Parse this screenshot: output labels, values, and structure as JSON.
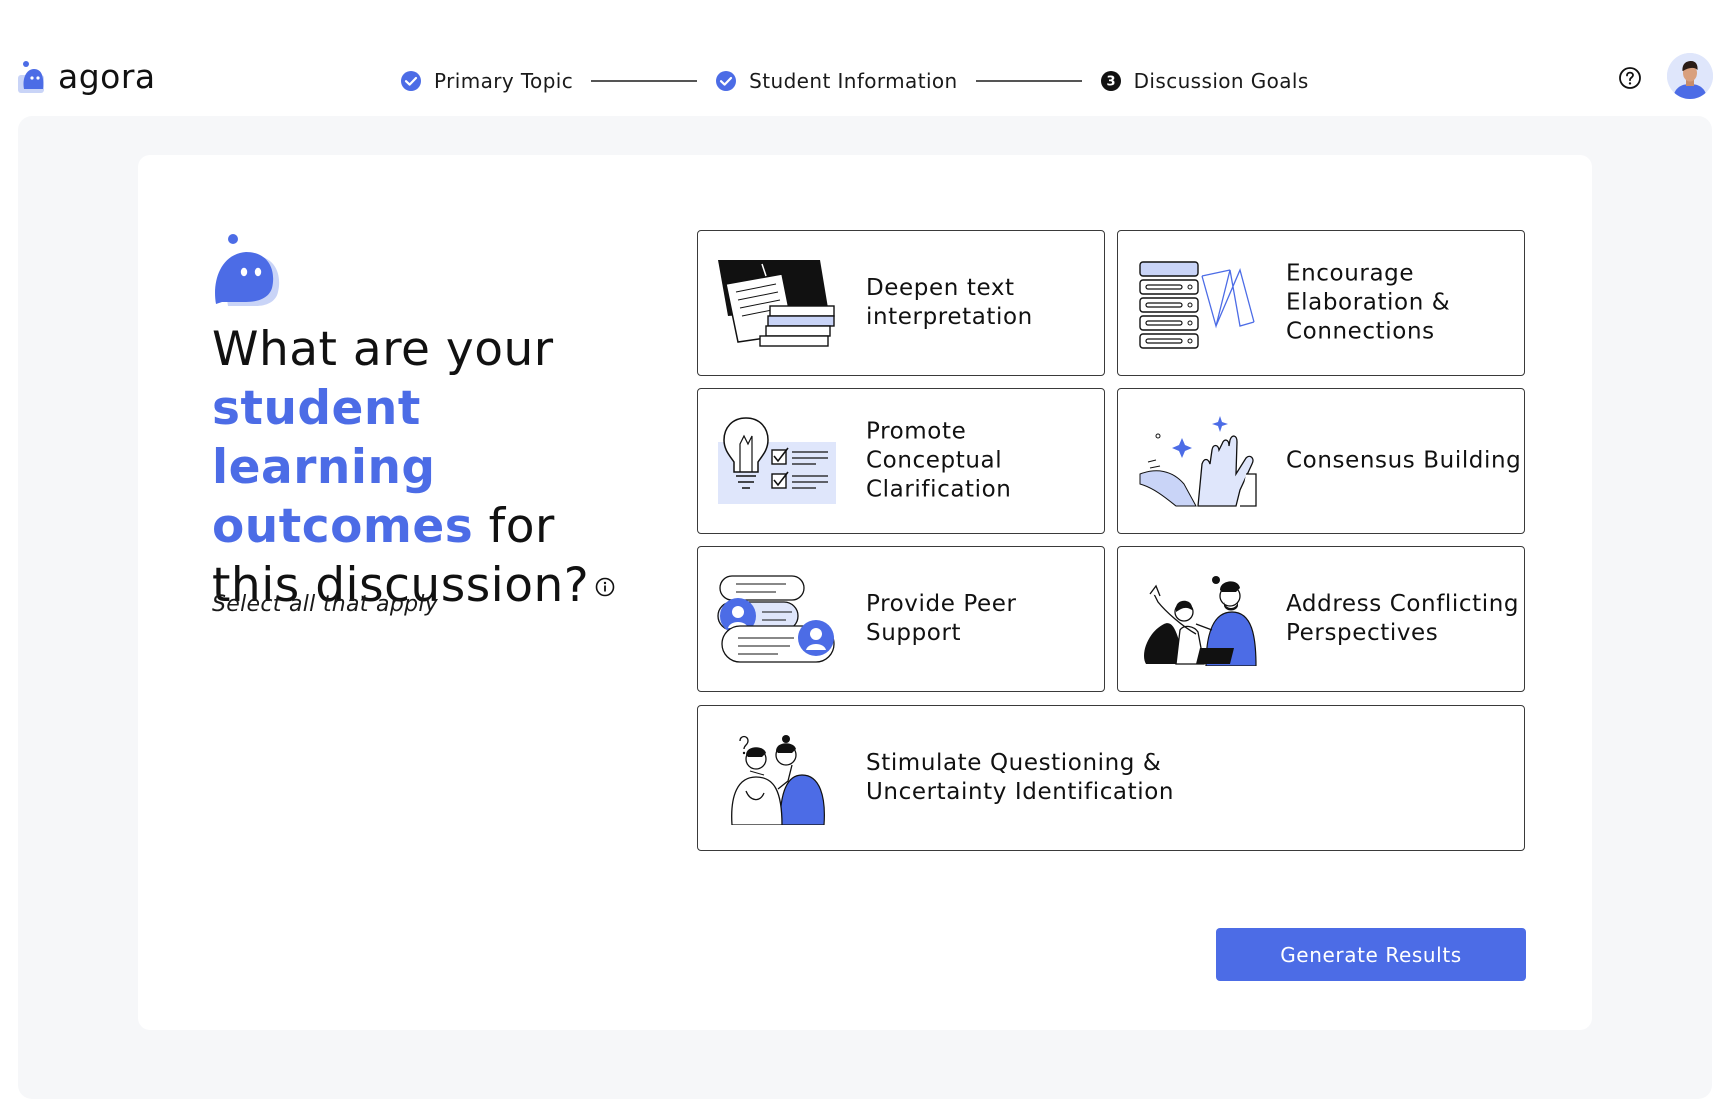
{
  "app": {
    "name": "agora"
  },
  "stepper": {
    "steps": [
      {
        "label": "Primary Topic",
        "state": "complete"
      },
      {
        "label": "Student Information",
        "state": "complete"
      },
      {
        "label": "Discussion Goals",
        "state": "current",
        "number": "3"
      }
    ]
  },
  "question": {
    "prefix": "What are your ",
    "highlight": "student learning outcomes",
    "suffix": " for this discussion?",
    "instruction": "Select all that apply"
  },
  "options": [
    {
      "label": "Deepen text interpretation",
      "icon": "books-papers-illustration"
    },
    {
      "label": "Encourage Elaboration & Connections",
      "icon": "server-network-illustration"
    },
    {
      "label": "Promote Conceptual Clarification",
      "icon": "lightbulb-checklist-illustration"
    },
    {
      "label": "Consensus Building",
      "icon": "high-five-hands-illustration"
    },
    {
      "label": "Provide Peer Support",
      "icon": "chat-bubbles-illustration"
    },
    {
      "label": "Address Conflicting Perspectives",
      "icon": "debating-people-illustration"
    },
    {
      "label": "Stimulate Questioning & Uncertainty Identification",
      "icon": "thinking-people-illustration"
    }
  ],
  "actions": {
    "generate_label": "Generate Results"
  },
  "colors": {
    "accent": "#4c6ce6",
    "panel": "#f6f7f9",
    "text": "#111111"
  }
}
